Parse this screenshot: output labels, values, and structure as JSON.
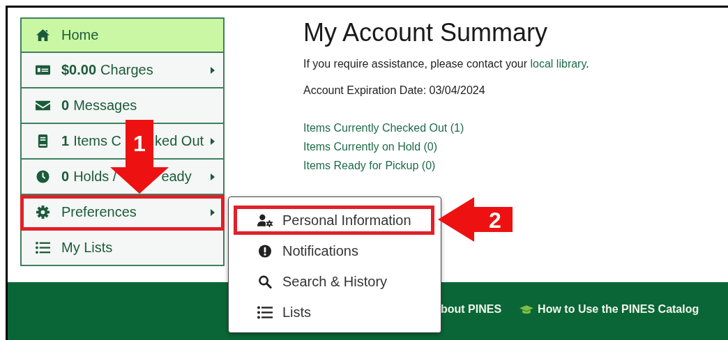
{
  "sidebar": {
    "items": [
      {
        "parts": [
          "Home"
        ],
        "selected": true,
        "has_submenu": false,
        "highlighted": false
      },
      {
        "count": "$0.00",
        "parts": [
          "Charges"
        ],
        "selected": false,
        "has_submenu": true,
        "highlighted": false
      },
      {
        "count": "0",
        "parts": [
          "Messages"
        ],
        "selected": false,
        "has_submenu": false,
        "highlighted": false
      },
      {
        "count": "1",
        "parts": [
          "Items C",
          "ked Out"
        ],
        "selected": false,
        "has_submenu": true,
        "highlighted": false
      },
      {
        "count": "0",
        "parts": [
          "Holds /",
          "eady"
        ],
        "selected": false,
        "has_submenu": true,
        "highlighted": false
      },
      {
        "parts": [
          "Preferences"
        ],
        "selected": false,
        "has_submenu": true,
        "highlighted": true
      },
      {
        "parts": [
          "My Lists"
        ],
        "selected": false,
        "has_submenu": false,
        "highlighted": false
      }
    ]
  },
  "main": {
    "title": "My Account Summary",
    "assistance": {
      "text": "If you require assistance, please contact your",
      "link": "local library",
      "end": "."
    },
    "expiration": "Account Expiration Date: 03/04/2024",
    "links": [
      "Items Currently Checked Out (1)",
      "Items Currently on Hold (0)",
      "Items Ready for Pickup (0)"
    ]
  },
  "dropdown": {
    "items": [
      {
        "label": "Personal Information",
        "highlighted": true
      },
      {
        "label": "Notifications",
        "highlighted": false
      },
      {
        "label": "Search & History",
        "highlighted": false
      },
      {
        "label": "Lists",
        "highlighted": false
      }
    ]
  },
  "footer": {
    "links": [
      {
        "label": "bout PINES",
        "icon": false
      },
      {
        "label": "How to Use the PINES Catalog",
        "icon": true
      }
    ]
  },
  "callouts": [
    {
      "label": "1",
      "kind": "down_arrow"
    },
    {
      "label": "2",
      "kind": "left_arrow"
    }
  ]
}
